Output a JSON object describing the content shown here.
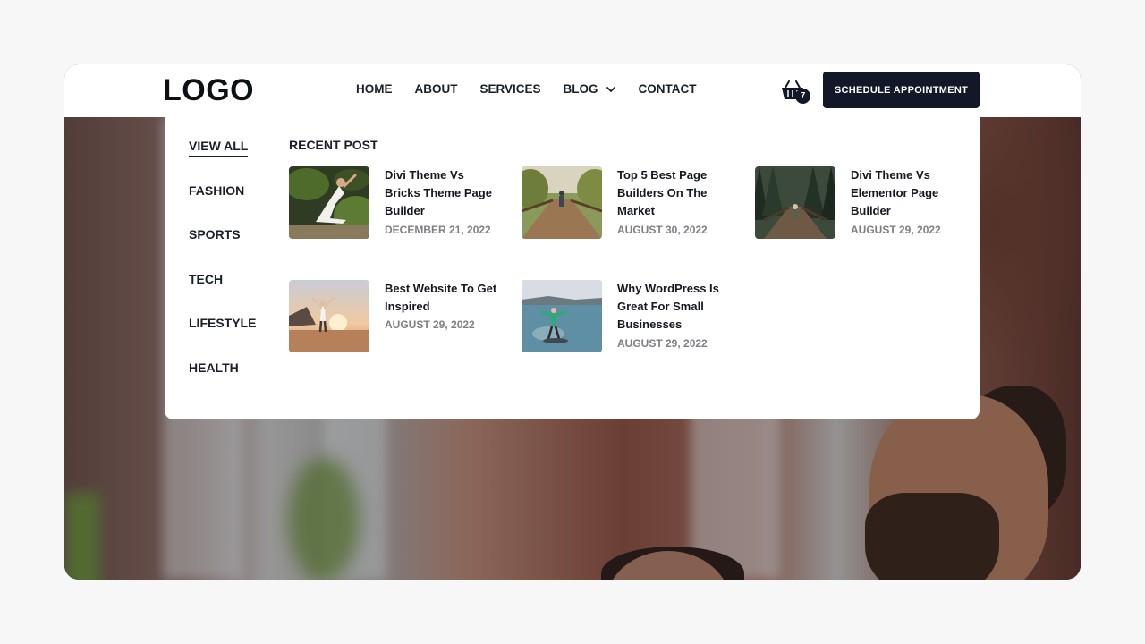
{
  "header": {
    "logo": "LOGO",
    "nav": [
      {
        "label": "HOME"
      },
      {
        "label": "ABOUT"
      },
      {
        "label": "SERVICES"
      },
      {
        "label": "BLOG"
      },
      {
        "label": "CONTACT"
      }
    ],
    "cart_count": "7",
    "cta_label": "SCHEDULE APPOINTMENT"
  },
  "mega_menu": {
    "categories": [
      "VIEW ALL",
      "FASHION",
      "SPORTS",
      "TECH",
      "LIFESTYLE",
      "HEALTH"
    ],
    "recent_title": "RECENT POST",
    "posts": [
      {
        "title": "Divi Theme Vs Bricks Theme Page Builder",
        "date": "DECEMBER 21, 2022"
      },
      {
        "title": "Top 5 Best Page Builders On The Market",
        "date": "AUGUST 30, 2022"
      },
      {
        "title": "Divi Theme Vs Elementor Page Builder",
        "date": "AUGUST 29, 2022"
      },
      {
        "title": "Best Website To Get Inspired",
        "date": "AUGUST 29, 2022"
      },
      {
        "title": "Why WordPress Is Great For Small Businesses",
        "date": "AUGUST 29, 2022"
      }
    ]
  },
  "colors": {
    "primary_dark": "#121827",
    "page_bg": "#f7f7f7",
    "date_gray": "#7d7f86"
  }
}
